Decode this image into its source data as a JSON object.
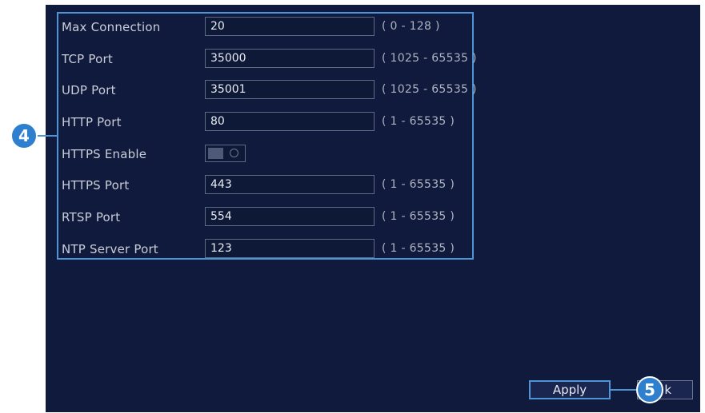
{
  "settings": {
    "rows": [
      {
        "label": "Max Connection",
        "value": "20",
        "range": "( 0 - 128 )"
      },
      {
        "label": "TCP Port",
        "value": "35000",
        "range": "( 1025 - 65535 )"
      },
      {
        "label": "UDP Port",
        "value": "35001",
        "range": "( 1025 - 65535 )"
      },
      {
        "label": "HTTP Port",
        "value": "80",
        "range": "( 1 - 65535 )"
      },
      {
        "label": "HTTPS Enable"
      },
      {
        "label": "HTTPS Port",
        "value": "443",
        "range": "( 1 - 65535 )"
      },
      {
        "label": "RTSP Port",
        "value": "554",
        "range": "( 1 - 65535 )"
      },
      {
        "label": "NTP Server Port",
        "value": "123",
        "range": "( 1 - 65535 )"
      }
    ],
    "https_enabled": false
  },
  "callouts": {
    "fields_step": "4",
    "apply_step": "5"
  },
  "buttons": {
    "apply_label": "Apply",
    "back_label": "k"
  },
  "colors": {
    "panel_bg": "#101a3c",
    "highlight": "#4d95d6",
    "callout_bg": "#2f7fcf"
  }
}
